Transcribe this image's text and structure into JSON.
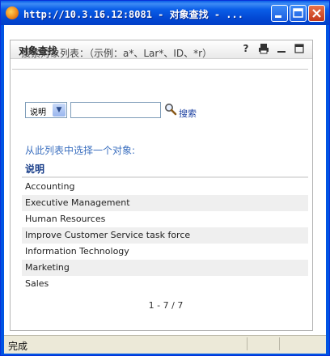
{
  "window": {
    "title": "http://10.3.16.12:8081 - 对象查找 - ...",
    "controls": [
      "minimize-icon",
      "maximize-icon",
      "close-icon"
    ]
  },
  "portlet": {
    "title": "对象查找",
    "header_icons": [
      "help-icon",
      "print-icon",
      "minimize-icon",
      "maximize-icon"
    ],
    "help_label": "?"
  },
  "search": {
    "hint": "搜索对象列表：（示例：a*、Lar*、ID、*r）",
    "select_value": "说明",
    "input_value": "",
    "button_label": "搜索"
  },
  "results": {
    "prompt": "从此列表中选择一个对象:",
    "column_header": "说明",
    "rows": [
      "Accounting",
      "Executive Management",
      "Human Resources",
      "Improve Customer Service task force",
      "Information Technology",
      "Marketing",
      "Sales"
    ],
    "pager": "1 - 7 / 7"
  },
  "status": {
    "text": "完成"
  }
}
